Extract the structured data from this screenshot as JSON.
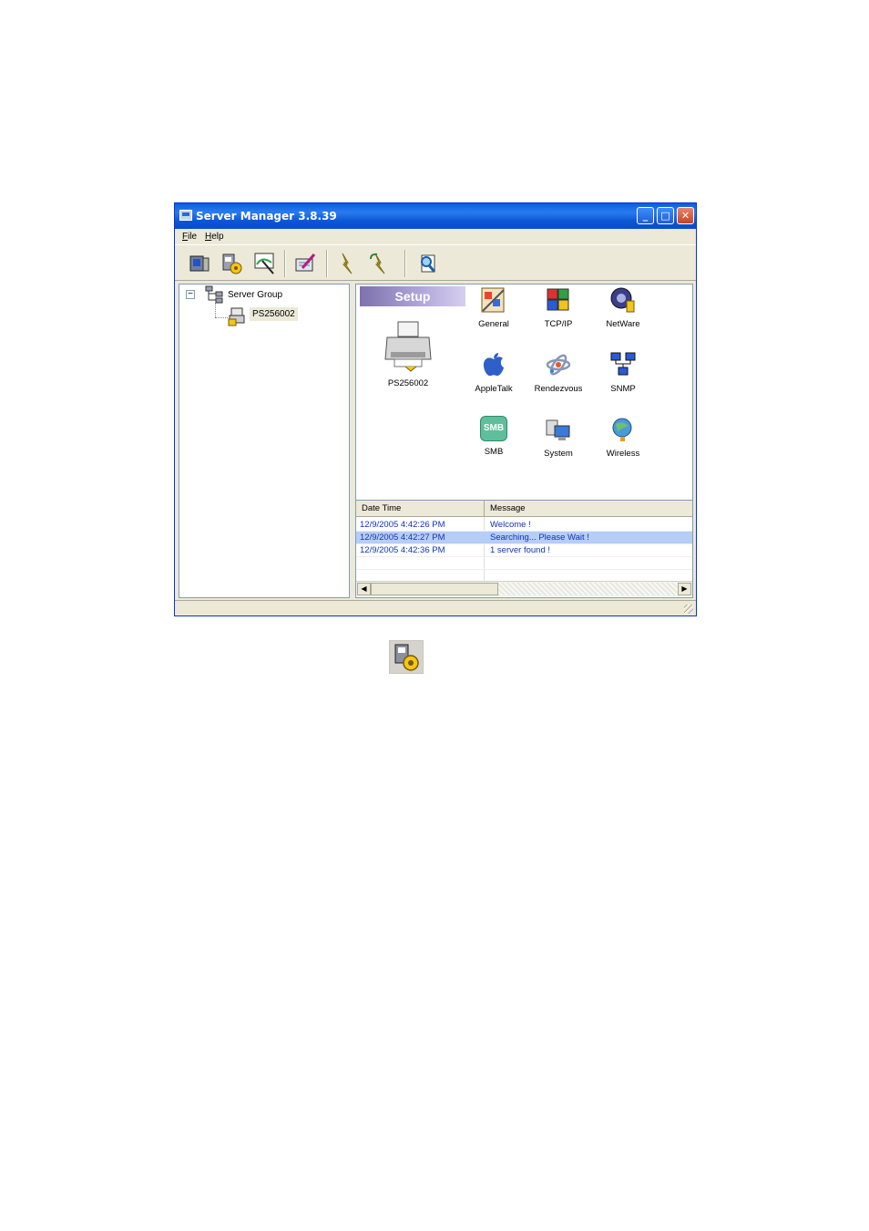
{
  "window": {
    "title": "Server Manager 3.8.39",
    "controls": {
      "minimize": "_",
      "maximize": "□",
      "close": "✕"
    }
  },
  "menu": {
    "file": "File",
    "help": "Help"
  },
  "toolbar": {
    "buttons": [
      {
        "icon": "server-monitor-icon"
      },
      {
        "icon": "gear-setup-icon"
      },
      {
        "icon": "search-network-icon"
      },
      {
        "icon": "edit-document-icon"
      },
      {
        "icon": "flash-upgrade-icon"
      },
      {
        "icon": "flash-restore-icon"
      },
      {
        "icon": "help-magnifier-icon"
      }
    ]
  },
  "tree": {
    "collapse_glyph": "−",
    "root_label": "Server Group",
    "child_label": "PS256002"
  },
  "setup": {
    "banner": "Setup",
    "device_label": "PS256002",
    "icons": [
      {
        "label": "General",
        "icon": "general-settings-icon"
      },
      {
        "label": "TCP/IP",
        "icon": "tcpip-icon"
      },
      {
        "label": "NetWare",
        "icon": "netware-icon"
      },
      {
        "label": "AppleTalk",
        "icon": "appletalk-icon"
      },
      {
        "label": "Rendezvous",
        "icon": "rendezvous-icon"
      },
      {
        "label": "SNMP",
        "icon": "snmp-icon"
      },
      {
        "label": "SMB",
        "icon": "smb-icon"
      },
      {
        "label": "System",
        "icon": "system-icon"
      },
      {
        "label": "Wireless",
        "icon": "wireless-icon"
      }
    ],
    "smb_badge": "SMB"
  },
  "log": {
    "columns": [
      "Date Time",
      "Message"
    ],
    "rows": [
      {
        "time": "12/9/2005 4:42:26 PM",
        "message": "Welcome !"
      },
      {
        "time": "12/9/2005 4:42:27 PM",
        "message": "Searching... Please Wait !"
      },
      {
        "time": "12/9/2005 4:42:36 PM",
        "message": "1 server found !"
      }
    ],
    "selected_row": 1
  },
  "scroll": {
    "left": "◀",
    "right": "▶"
  },
  "colors": {
    "titlebar": "#0a56d6",
    "setup_banner": "#9d91c9",
    "log_text": "#1133bb",
    "selection": "#b6cdf5"
  }
}
